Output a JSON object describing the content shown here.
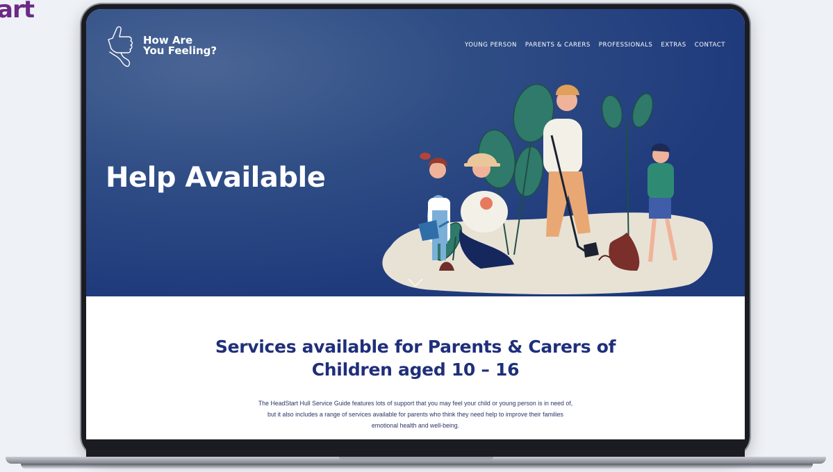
{
  "brand_corner": "art",
  "site": {
    "logo_line1": "How Are",
    "logo_line2": "You Feeling?"
  },
  "nav": {
    "items": [
      "YOUNG PERSON",
      "PARENTS & CARERS",
      "PROFESSIONALS",
      "EXTRAS",
      "CONTACT"
    ]
  },
  "hero": {
    "title": "Help Available"
  },
  "content": {
    "heading": "Services available for Parents & Carers of Children aged 10 – 16",
    "body": "The HeadStart Hull Service Guide features lots of support that you may feel your child or young person is in need of, but it also includes a range of services available for parents who think they need help to improve their families emotional health and well-being."
  },
  "colors": {
    "hero_bg": "#203b7c",
    "heading": "#1f2f7a",
    "brand_purple": "#6b2a86"
  },
  "icons": {
    "logo": "thumbs-up-icon",
    "scroll": "chevron-down-icon"
  }
}
